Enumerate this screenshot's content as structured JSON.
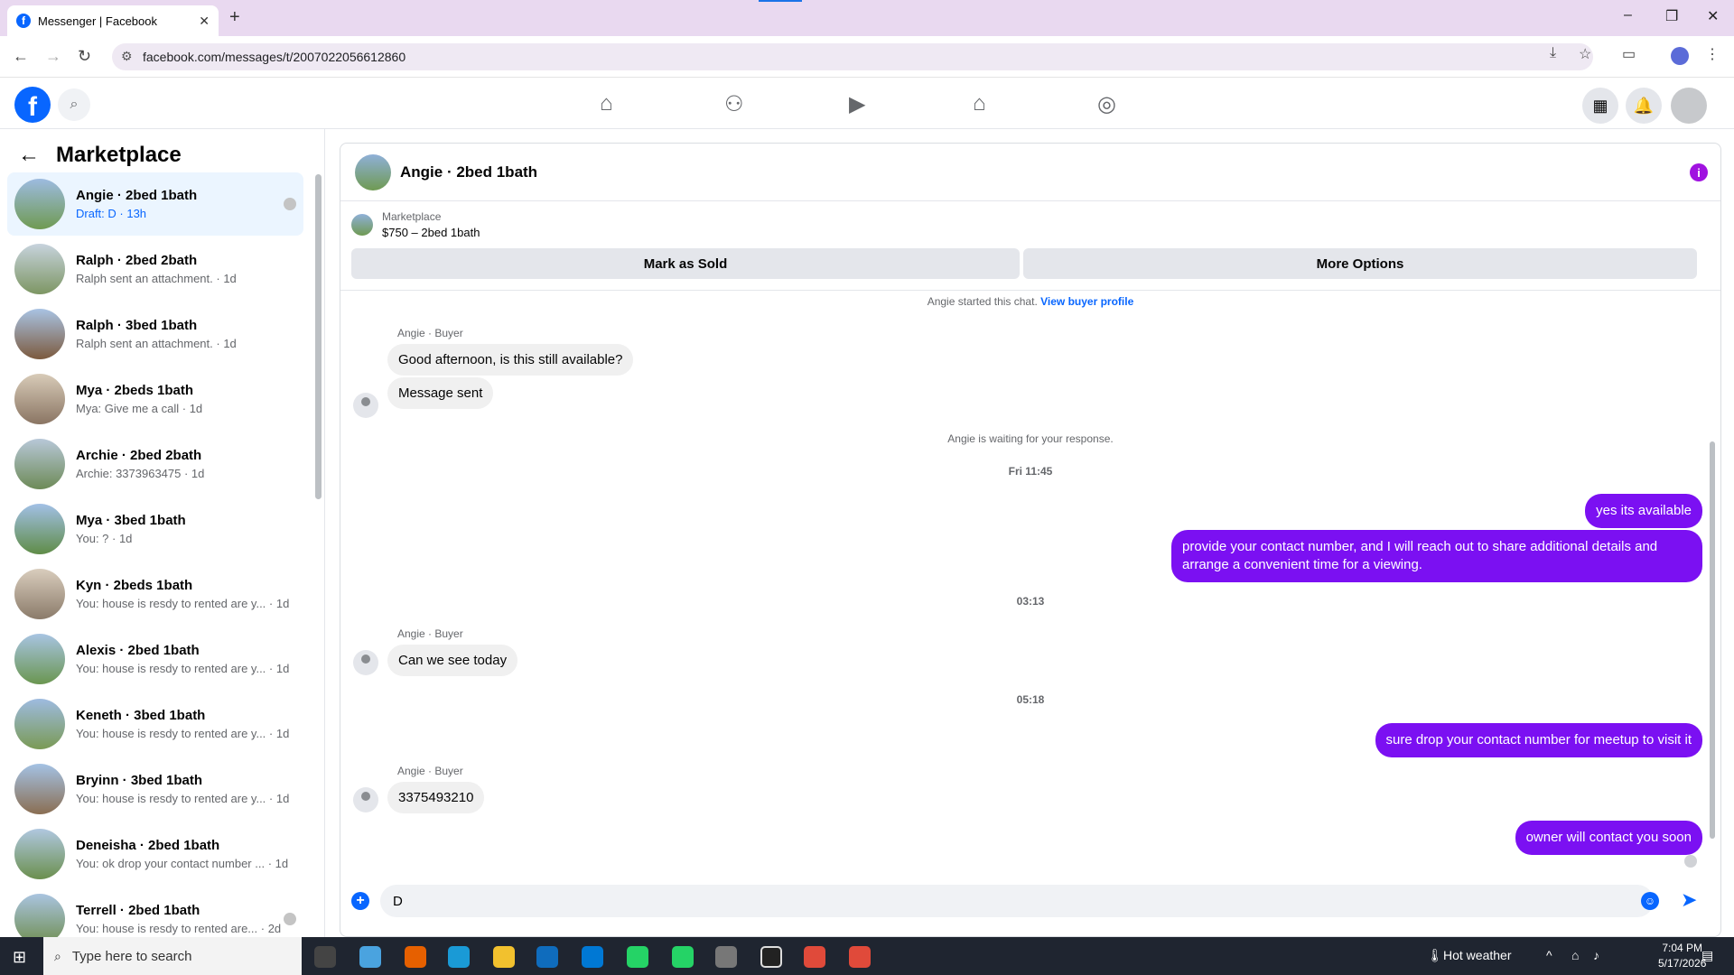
{
  "browser": {
    "tab_title": "Messenger | Facebook",
    "tab_close": "✕",
    "new_tab": "+",
    "url": "facebook.com/messages/t/2007022056612860",
    "window_controls": [
      "–",
      "❐",
      "✕"
    ]
  },
  "fb_nav": {
    "logo_glyph": "f",
    "icons": [
      "home-icon",
      "friends-icon",
      "video-icon",
      "marketplace-icon",
      "groups-icon"
    ]
  },
  "sidebar": {
    "title": "Marketplace",
    "conversations": [
      {
        "name": "Angie · 2bed 1bath",
        "snippet": "Draft: D · 13h",
        "active": true
      },
      {
        "name": "Ralph · 2bed 2bath",
        "snippet": "Ralph sent an attachment. · 1d"
      },
      {
        "name": "Ralph · 3bed 1bath",
        "snippet": "Ralph sent an attachment. · 1d"
      },
      {
        "name": "Mya · 2beds 1bath",
        "snippet": "Mya: Give me a call · 1d"
      },
      {
        "name": "Archie · 2bed 2bath",
        "snippet": "Archie: 3373963475 · 1d"
      },
      {
        "name": "Mya · 3bed 1bath",
        "snippet": "You: ? · 1d"
      },
      {
        "name": "Kyn · 2beds 1bath",
        "snippet": "You: house is resdy to rented are y... · 1d"
      },
      {
        "name": "Alexis · 2bed 1bath",
        "snippet": "You: house is resdy to rented are y... · 1d"
      },
      {
        "name": "Keneth · 3bed 1bath",
        "snippet": "You: house is resdy to rented are y... · 1d"
      },
      {
        "name": "Bryinn · 3bed 1bath",
        "snippet": "You: house is resdy to rented are y... · 1d"
      },
      {
        "name": "Deneisha · 2bed 1bath",
        "snippet": "You: ok drop your contact number ... · 1d"
      },
      {
        "name": "Terrell · 2bed 1bath",
        "snippet": "You: house is resdy to rented are... · 2d"
      }
    ]
  },
  "chat": {
    "title": "Angie · 2bed 1bath",
    "listing_label": "Marketplace",
    "listing_detail": "$750 – 2bed 1bath",
    "mark_sold": "Mark as Sold",
    "more_options": "More Options",
    "started": "Angie started this chat.",
    "view_profile": "View buyer profile",
    "sender_label": "Angie · Buyer",
    "msg1": "Good afternoon, is this still available?",
    "msg2": "Message sent",
    "waiting": "Angie is waiting for your response.",
    "time1": "Fri 11:45",
    "out1": "yes its available",
    "out2": "provide your contact number, and I will reach out to share additional details and arrange a convenient time for a viewing.",
    "time2": "03:13",
    "msg3": "Can we see today",
    "time3": "05:18",
    "out3": "sure drop your contact number for meetup to visit it",
    "msg4": "3375493210",
    "out4": "owner will contact you soon",
    "composer_value": "D"
  },
  "taskbar": {
    "search_placeholder": "Type here to search",
    "weather": "Hot weather",
    "time": "7:04 PM",
    "date": "5/17/2026"
  },
  "colors": {
    "fb_blue": "#0866ff",
    "outgoing_bubble": "#7b10f2",
    "active_row": "#ebf5ff"
  }
}
